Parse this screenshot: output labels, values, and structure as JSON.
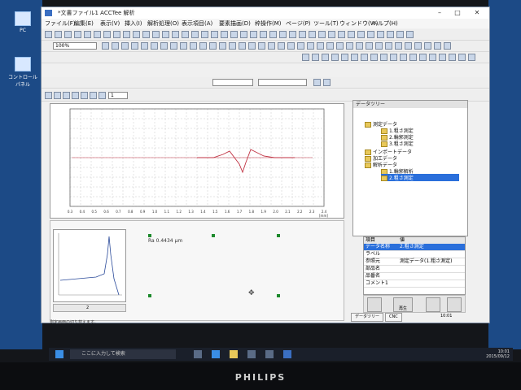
{
  "desktop": {
    "icons": [
      {
        "label": "PC"
      },
      {
        "label": "e"
      },
      {
        "label": "コントロール パネル"
      }
    ]
  },
  "window": {
    "title": "*文書ファイル1 ACCTee 解析",
    "menus": [
      "ファイル(F)",
      "編集(E)",
      "表示(V)",
      "挿入(I)",
      "解析処理(O)",
      "表示項目(A)",
      "要素描画(D)",
      "枠操作(M)",
      "ページ(P)",
      "ツール(T)",
      "ウィンドウ(W)",
      "ヘルプ(H)"
    ],
    "zoom": "100%",
    "page_field": "1"
  },
  "graph": {
    "x_ticks": [
      "0.3",
      "0.4",
      "0.5",
      "0.6",
      "0.7",
      "0.8",
      "0.9",
      "1.0",
      "1.1",
      "1.2",
      "1.3",
      "1.4",
      "1.5",
      "1.6",
      "1.7",
      "1.8",
      "1.9",
      "2.0",
      "2.1",
      "2.2",
      "2.3",
      "2.4"
    ],
    "x_unit": "[mm]"
  },
  "lower": {
    "measurement": "Ra     0.4434 μm"
  },
  "status": {
    "text": "測定画面の切り替えます。",
    "page": "2"
  },
  "tree": {
    "header": "データツリー",
    "nodes": [
      {
        "label": "測定データ"
      },
      {
        "label": "1.粗さ測定"
      },
      {
        "label": "2.輪郭測定"
      },
      {
        "label": "3.粗さ測定"
      },
      {
        "label": "インポートデータ"
      },
      {
        "label": "加工データ"
      },
      {
        "label": "解析データ"
      },
      {
        "label": "1.輪郭解析"
      },
      {
        "label": "2.粗さ測定"
      }
    ]
  },
  "props": {
    "header_key": "項目",
    "header_value": "値",
    "rows": [
      {
        "key": "データ名称",
        "value": "2.粗さ測定"
      },
      {
        "key": "ラベル",
        "value": ""
      },
      {
        "key": "参照元",
        "value": "測定データ(1.粗さ測定)"
      },
      {
        "key": "部品名",
        "value": ""
      },
      {
        "key": "品番名",
        "value": ""
      },
      {
        "key": "コメント1",
        "value": ""
      }
    ]
  },
  "nav": {
    "play_label": "再生"
  },
  "tabs": [
    "データツリー",
    "CNC"
  ],
  "pane_time": "10:01",
  "taskbar": {
    "search_placeholder": "ここに入力して検索",
    "time": "10:01",
    "date": "2015/09/12"
  },
  "monitor_brand": "PHILIPS",
  "colors": {
    "selection": "#2a6fdb",
    "curve": "#c03040",
    "handle": "#1e8a2d"
  }
}
